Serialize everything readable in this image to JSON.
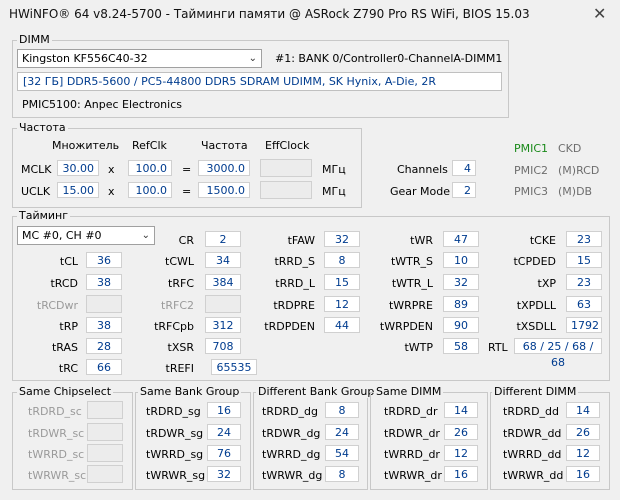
{
  "window": {
    "title": "HWiNFO® 64 v8.24-5700 - Тайминги памяти @ ASRock Z790 Pro RS WiFi, BIOS 15.03",
    "close_icon": "close-icon"
  },
  "dimm": {
    "group_label": "DIMM",
    "selected_module": "Kingston KF556C40-32",
    "bank": "#1: BANK 0/Controller0-ChannelA-DIMM1",
    "description": "[32 ГБ] DDR5-5600 / PC5-44800 DDR5 SDRAM UDIMM, SK Hynix, A-Die, 2R",
    "pmic": "PMIC5100: Anpec Electronics"
  },
  "freq": {
    "group_label": "Частота",
    "headers": {
      "mult": "Множитель",
      "refclk": "RefClk",
      "freq": "Частота",
      "eff": "EffClock"
    },
    "mclk": {
      "label": "MCLK",
      "mult": "30.00",
      "x": "x",
      "refclk": "100.0",
      "eq": "=",
      "freq": "3000.0",
      "eff": "",
      "unit": "МГц"
    },
    "uclk": {
      "label": "UCLK",
      "mult": "15.00",
      "x": "x",
      "refclk": "100.0",
      "eq": "=",
      "freq": "1500.0",
      "eff": "",
      "unit": "МГц"
    },
    "channels_label": "Channels",
    "channels": "4",
    "gear_label": "Gear Mode",
    "gear": "2",
    "pmic1": "PMIC1",
    "pmic1_val": "CKD",
    "pmic2": "PMIC2",
    "pmic2_val": "(M)RCD",
    "pmic3": "PMIC3",
    "pmic3_val": "(M)DB"
  },
  "timing": {
    "group_label": "Тайминг",
    "channel_select": "MC #0, CH #0",
    "tCL": "36",
    "tRCD": "38",
    "tRCDwr": "",
    "tRP": "38",
    "tRAS": "28",
    "tRC": "66",
    "CR": "2",
    "tCWL": "34",
    "tRFC": "384",
    "tRFC2": "",
    "tRFCpb": "312",
    "tXSR": "708",
    "tREFI": "65535",
    "tFAW": "32",
    "tRRD_S": "8",
    "tRRD_L": "15",
    "tRDPRE": "12",
    "tRDPDEN": "44",
    "tWR": "47",
    "tWTR_S": "10",
    "tWTR_L": "32",
    "tWRPRE": "89",
    "tWRPDEN": "90",
    "tWTP": "58",
    "tCKE": "23",
    "tCPDED": "15",
    "tXP": "23",
    "tXPDLL": "63",
    "tXSDLL": "1792",
    "RTL_label": "RTL",
    "RTL": "68 / 25 / 68 / 68",
    "labels": {
      "tCL": "tCL",
      "tRCD": "tRCD",
      "tRCDwr": "tRCDwr",
      "tRP": "tRP",
      "tRAS": "tRAS",
      "tRC": "tRC",
      "CR": "CR",
      "tCWL": "tCWL",
      "tRFC": "tRFC",
      "tRFC2": "tRFC2",
      "tRFCpb": "tRFCpb",
      "tXSR": "tXSR",
      "tREFI": "tREFI",
      "tFAW": "tFAW",
      "tRRD_S": "tRRD_S",
      "tRRD_L": "tRRD_L",
      "tRDPRE": "tRDPRE",
      "tRDPDEN": "tRDPDEN",
      "tWR": "tWR",
      "tWTR_S": "tWTR_S",
      "tWTR_L": "tWTR_L",
      "tWRPRE": "tWRPRE",
      "tWRPDEN": "tWRPDEN",
      "tWTP": "tWTP",
      "tCKE": "tCKE",
      "tCPDED": "tCPDED",
      "tXP": "tXP",
      "tXPDLL": "tXPDLL",
      "tXSDLL": "tXSDLL"
    }
  },
  "bottom": {
    "same_cs": {
      "label": "Same Chipselect",
      "rows": [
        {
          "name": "tRDRD_sc",
          "value": ""
        },
        {
          "name": "tRDWR_sc",
          "value": ""
        },
        {
          "name": "tWRRD_sc",
          "value": ""
        },
        {
          "name": "tWRWR_sc",
          "value": ""
        }
      ]
    },
    "same_bg": {
      "label": "Same Bank Group",
      "rows": [
        {
          "name": "tRDRD_sg",
          "value": "16"
        },
        {
          "name": "tRDWR_sg",
          "value": "24"
        },
        {
          "name": "tWRRD_sg",
          "value": "76"
        },
        {
          "name": "tWRWR_sg",
          "value": "32"
        }
      ]
    },
    "diff_bg": {
      "label": "Different Bank Group",
      "rows": [
        {
          "name": "tRDRD_dg",
          "value": "8"
        },
        {
          "name": "tRDWR_dg",
          "value": "24"
        },
        {
          "name": "tWRRD_dg",
          "value": "54"
        },
        {
          "name": "tWRWR_dg",
          "value": "8"
        }
      ]
    },
    "same_dimm": {
      "label": "Same DIMM",
      "rows": [
        {
          "name": "tRDRD_dr",
          "value": "14"
        },
        {
          "name": "tRDWR_dr",
          "value": "26"
        },
        {
          "name": "tWRRD_dr",
          "value": "12"
        },
        {
          "name": "tWRWR_dr",
          "value": "16"
        }
      ]
    },
    "diff_dimm": {
      "label": "Different DIMM",
      "rows": [
        {
          "name": "tRDRD_dd",
          "value": "14"
        },
        {
          "name": "tRDWR_dd",
          "value": "26"
        },
        {
          "name": "tWRRD_dd",
          "value": "12"
        },
        {
          "name": "tWRWR_dd",
          "value": "16"
        }
      ]
    }
  }
}
